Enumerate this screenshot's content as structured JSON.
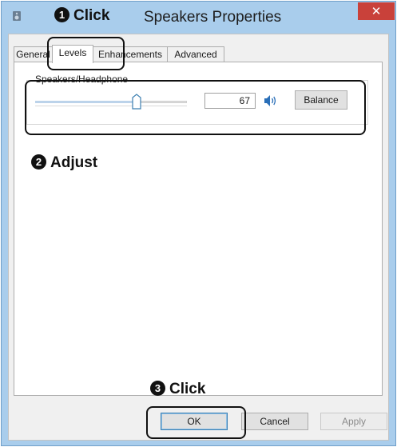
{
  "window": {
    "title": "Speakers Properties",
    "close_glyph": "✕"
  },
  "tabs": [
    {
      "label": "General",
      "active": false
    },
    {
      "label": "Levels",
      "active": true
    },
    {
      "label": "Enhancements",
      "active": false
    },
    {
      "label": "Advanced",
      "active": false
    }
  ],
  "levels": {
    "group_label": "Speakers/Headphone",
    "volume_value": "67",
    "volume_fraction": 0.67,
    "speaker_icon": "speaker-volume-icon",
    "balance_label": "Balance"
  },
  "buttons": {
    "ok": "OK",
    "cancel": "Cancel",
    "apply": "Apply"
  },
  "callouts": {
    "step1": {
      "number": "1",
      "text": "Click"
    },
    "step2": {
      "number": "2",
      "text": "Adjust"
    },
    "step3": {
      "number": "3",
      "text": "Click"
    }
  },
  "colors": {
    "title_bar": "#a9cdec",
    "close_button": "#c9413a",
    "accent": "#3c7fb1"
  }
}
